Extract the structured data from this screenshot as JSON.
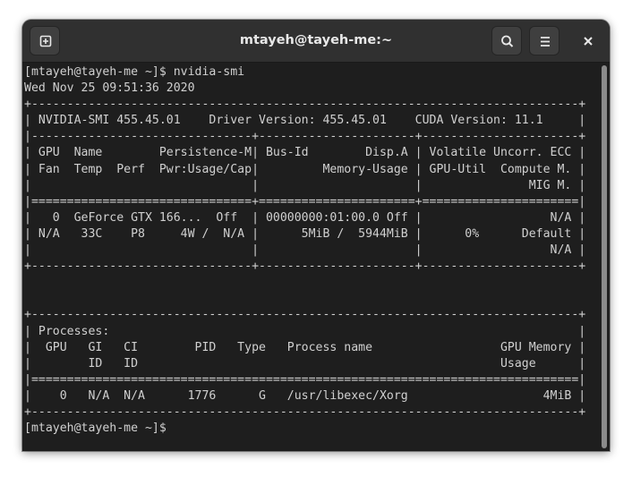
{
  "window": {
    "title": "mtayeh@tayeh-me:~"
  },
  "titlebar": {
    "new_tab_icon": "new-tab-icon",
    "search_icon": "search-icon",
    "menu_icon": "hamburger-menu-icon",
    "close_icon": "close-icon"
  },
  "colors": {
    "window_bg": "#1e1e1e",
    "titlebar_bg": "#303030",
    "text": "#d0d0d0",
    "scroll_thumb": "#8a8a8a"
  },
  "terminal": {
    "lines": [
      "[mtayeh@tayeh-me ~]$ nvidia-smi",
      "Wed Nov 25 09:51:36 2020",
      "+-----------------------------------------------------------------------------+",
      "| NVIDIA-SMI 455.45.01    Driver Version: 455.45.01    CUDA Version: 11.1     |",
      "|-------------------------------+----------------------+----------------------+",
      "| GPU  Name        Persistence-M| Bus-Id        Disp.A | Volatile Uncorr. ECC |",
      "| Fan  Temp  Perf  Pwr:Usage/Cap|         Memory-Usage | GPU-Util  Compute M. |",
      "|                               |                      |               MIG M. |",
      "|===============================+======================+======================|",
      "|   0  GeForce GTX 166...  Off  | 00000000:01:00.0 Off |                  N/A |",
      "| N/A   33C    P8     4W /  N/A |      5MiB /  5944MiB |      0%      Default |",
      "|                               |                      |                  N/A |",
      "+-------------------------------+----------------------+----------------------+",
      "",
      "",
      "+-----------------------------------------------------------------------------+",
      "| Processes:                                                                  |",
      "|  GPU   GI   CI        PID   Type   Process name                  GPU Memory |",
      "|        ID   ID                                                   Usage      |",
      "|=============================================================================|",
      "|    0   N/A  N/A      1776      G   /usr/libexec/Xorg                   4MiB |",
      "+-----------------------------------------------------------------------------+",
      "[mtayeh@tayeh-me ~]$ "
    ]
  }
}
